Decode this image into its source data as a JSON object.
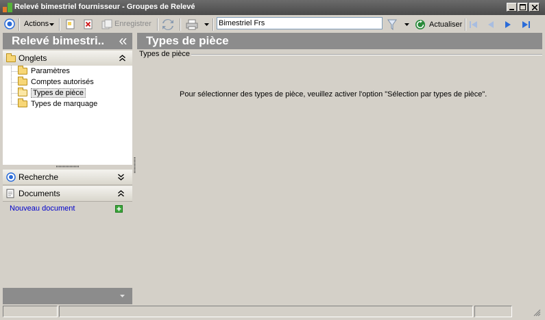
{
  "window": {
    "title": "Relevé bimestriel fournisseur  -  Groupes de Relevé",
    "controls": [
      "minimize",
      "maximize",
      "close"
    ]
  },
  "toolbar": {
    "actions_label": "Actions",
    "save_label": "Enregistrer",
    "search_value": "Bimestriel Frs",
    "refresh_label": "Actualiser"
  },
  "left_panel": {
    "header_title": "Relevé bimestri..",
    "tabs_section_label": "Onglets",
    "tree_items": [
      {
        "label": "Paramètres",
        "selected": false
      },
      {
        "label": "Comptes autorisés",
        "selected": false
      },
      {
        "label": "Types de pièce",
        "selected": true
      },
      {
        "label": "Types de marquage",
        "selected": false
      }
    ],
    "search_section_label": "Recherche",
    "documents_section_label": "Documents",
    "new_document_link": "Nouveau document"
  },
  "main": {
    "header_title": "Types de pièce",
    "group_label": "Types de pièce",
    "message": "Pour sélectionner des types de pièce, veuillez activer l'option \"Sélection par types de pièce\"."
  },
  "colors": {
    "header_bg": "#8c8c8c",
    "window_bg": "#d4d0c8",
    "link": "#0000cc",
    "accent_blue": "#2a6bd8"
  }
}
